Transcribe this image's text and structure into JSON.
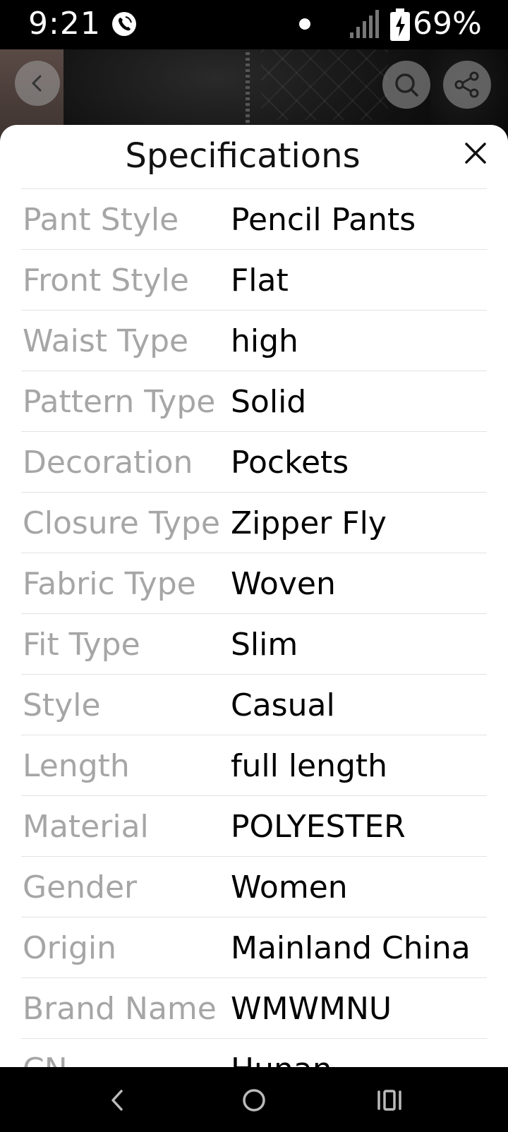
{
  "status_bar": {
    "time": "9:21",
    "battery": "69%"
  },
  "icons": {
    "back": "chevron-left-icon",
    "search": "search-icon",
    "share": "share-icon",
    "close": "close-icon",
    "call": "wifi-call-icon",
    "signal": "signal-icon",
    "battery": "battery-charging-icon"
  },
  "sheet": {
    "title": "Specifications",
    "specs": [
      {
        "label": "Pant Style",
        "value": "Pencil Pants"
      },
      {
        "label": "Front Style",
        "value": "Flat"
      },
      {
        "label": "Waist Type",
        "value": "high"
      },
      {
        "label": "Pattern Type",
        "value": "Solid"
      },
      {
        "label": "Decoration",
        "value": "Pockets"
      },
      {
        "label": "Closure Type",
        "value": "Zipper Fly"
      },
      {
        "label": "Fabric Type",
        "value": "Woven"
      },
      {
        "label": "Fit Type",
        "value": "Slim"
      },
      {
        "label": "Style",
        "value": "Casual"
      },
      {
        "label": "Length",
        "value": "full length"
      },
      {
        "label": "Material",
        "value": "POLYESTER"
      },
      {
        "label": "Gender",
        "value": "Women"
      },
      {
        "label": "Origin",
        "value": "Mainland China"
      },
      {
        "label": "Brand Name",
        "value": "WMWMNU"
      },
      {
        "label": "CN",
        "value": "Hunan"
      }
    ]
  },
  "colors": {
    "label": "#a6a6a6",
    "value": "#000000",
    "divider": "#e2e2e2",
    "overlay_button": "#a0a0a0"
  }
}
